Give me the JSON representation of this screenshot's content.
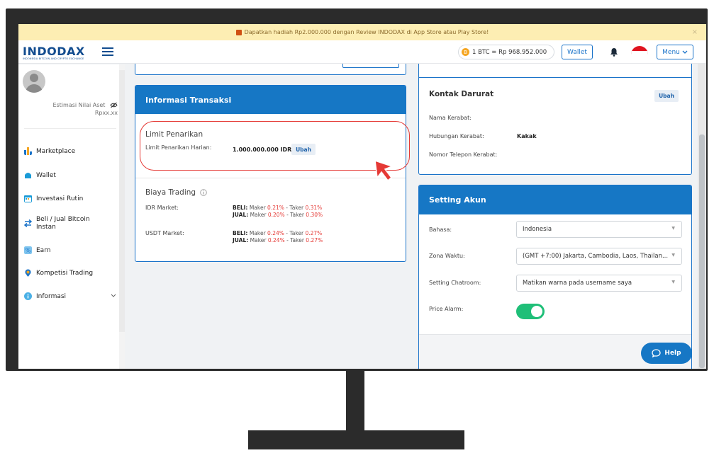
{
  "banner": {
    "text": "Dapatkan hadiah Rp2.000.000 dengan Review INDODAX di App Store atau Play Store!",
    "close": "×"
  },
  "topbar": {
    "logo": "INDODAX",
    "logo_sub": "INDONESIA BITCOIN AND CRYPTO EXCHANGE",
    "btc_rate": "1 BTC = Rp 968.952.000",
    "btc_symbol": "B",
    "wallet_label": "Wallet",
    "menu_label": "Menu"
  },
  "sidebar": {
    "estimasi_label": "Estimasi Nilai Aset",
    "estimasi_value": "Rpxx.xx",
    "items": [
      {
        "label": "Marketplace",
        "icon": "bar-chart-icon",
        "color": "#1a73c9"
      },
      {
        "label": "Wallet",
        "icon": "wallet-icon",
        "color": "#1a9bd7"
      },
      {
        "label": "Investasi Rutin",
        "icon": "calendar-icon",
        "color": "#1a9bd7"
      },
      {
        "label": "Beli / Jual Bitcoin Instan",
        "icon": "swap-icon",
        "color": "#1a73c9"
      },
      {
        "label": "Earn",
        "icon": "percent-icon",
        "color": "#4ab0e6"
      },
      {
        "label": "Kompetisi Trading",
        "icon": "medal-icon",
        "color": "#1a73c9"
      },
      {
        "label": "Informasi",
        "icon": "info-icon",
        "color": "#4ab0e6"
      }
    ]
  },
  "transaksi": {
    "title": "Informasi Transaksi",
    "limit_title": "Limit Penarikan",
    "limit_label": "Limit Penarikan Harian:",
    "limit_value": "1.000.000.000 IDR",
    "ubah": "Ubah",
    "biaya_title": "Biaya Trading",
    "idr_label": "IDR Market:",
    "usdt_label": "USDT Market:",
    "beli": "BELI:",
    "jual": "JUAL:",
    "maker": "Maker",
    "taker": "Taker",
    "dash": "-",
    "idr_beli_maker": "0.21%",
    "idr_beli_taker": "0.31%",
    "idr_jual_maker": "0.20%",
    "idr_jual_taker": "0.30%",
    "usdt_beli_maker": "0.24%",
    "usdt_beli_taker": "0.27%",
    "usdt_jual_maker": "0.24%",
    "usdt_jual_taker": "0.27%"
  },
  "kontak": {
    "title": "Kontak Darurat",
    "ubah": "Ubah",
    "nama_label": "Nama Kerabat:",
    "hubungan_label": "Hubungan Kerabat:",
    "hubungan_value": "Kakak",
    "telepon_label": "Nomor Telepon Kerabat:"
  },
  "setting": {
    "title": "Setting Akun",
    "bahasa_label": "Bahasa:",
    "bahasa_value": "Indonesia",
    "zona_label": "Zona Waktu:",
    "zona_value": "(GMT +7:00) Jakarta, Cambodia, Laos, Thailan...",
    "chat_label": "Setting Chatroom:",
    "chat_value": "Matikan warna pada username saya",
    "alarm_label": "Price Alarm:",
    "alarm_on": true
  },
  "help": {
    "label": "Help"
  },
  "colors": {
    "accent": "#1677c5",
    "highlight": "#e53935",
    "toggle": "#1fbf78"
  }
}
